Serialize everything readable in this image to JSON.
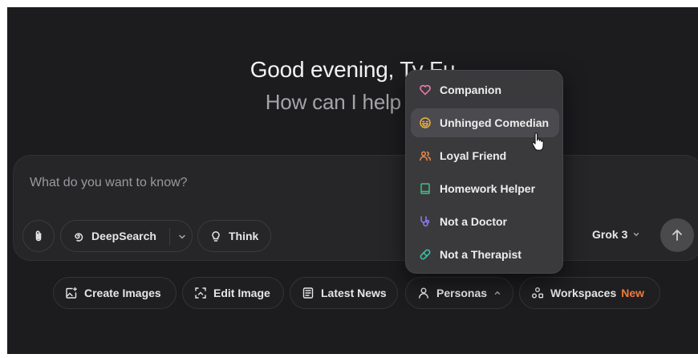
{
  "hero": {
    "greeting": "Good evening, Ty Fu",
    "subtitle": "How can I help you"
  },
  "composer": {
    "placeholder": "What do you want to know?",
    "buttons": {
      "deepsearch": "DeepSearch",
      "think": "Think"
    },
    "model": "Grok 3"
  },
  "quick_actions": {
    "create_images": "Create Images",
    "edit_image": "Edit Image",
    "latest_news": "Latest News",
    "personas": "Personas",
    "workspaces": "Workspaces",
    "workspaces_badge": "New"
  },
  "personas_menu": {
    "items": [
      {
        "label": "Companion",
        "icon": "heart-icon",
        "color": "#f07aa8"
      },
      {
        "label": "Unhinged Comedian",
        "icon": "laughing-face-icon",
        "color": "#f0b23a"
      },
      {
        "label": "Loyal Friend",
        "icon": "users-icon",
        "color": "#ef8a4a"
      },
      {
        "label": "Homework Helper",
        "icon": "book-icon",
        "color": "#3fbf86"
      },
      {
        "label": "Not a Doctor",
        "icon": "stethoscope-icon",
        "color": "#8a7cf0"
      },
      {
        "label": "Not a Therapist",
        "icon": "pill-icon",
        "color": "#3fc3a8"
      }
    ],
    "hovered": "Unhinged Comedian"
  },
  "colors": {
    "background": "#1c1c1e",
    "composer": "#262628",
    "menu": "#3a3a3d",
    "accent_new": "#ee7a3e"
  }
}
